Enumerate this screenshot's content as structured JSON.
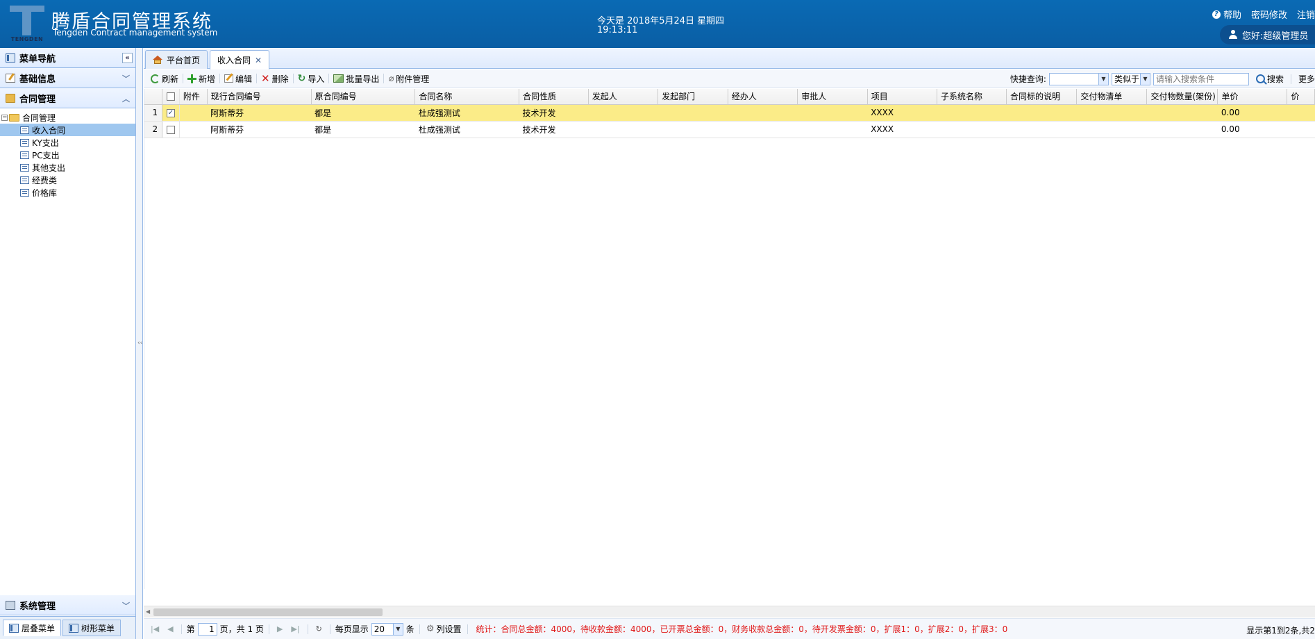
{
  "header": {
    "logo_word": "TENGDEN",
    "title_cn": "腾盾合同管理系统",
    "title_en": "Tengden Contract management system",
    "date": "今天是 2018年5月24日 星期四",
    "time": "19:13:11",
    "help": "帮助",
    "change_password": "密码修改",
    "logout": "注销",
    "greeting": "您好:超级管理员"
  },
  "sidebar": {
    "nav_title": "菜单导航",
    "sections": {
      "basic": "基础信息",
      "contract": "合同管理",
      "system": "系统管理"
    },
    "tree": {
      "root": "合同管理",
      "items": [
        "收入合同",
        "KY支出",
        "PC支出",
        "其他支出",
        "经费类",
        "价格库"
      ]
    },
    "bottom_tabs": [
      "层叠菜单",
      "树形菜单"
    ]
  },
  "tabs": [
    "平台首页",
    "收入合同"
  ],
  "toolbar": {
    "refresh": "刷新",
    "add": "新增",
    "edit": "编辑",
    "delete": "删除",
    "import": "导入",
    "batch_export": "批量导出",
    "attachments": "附件管理",
    "quick_query_label": "快捷查询:",
    "quick_field_value": "",
    "match_mode": "类似于",
    "search_placeholder": "请输入搜索条件",
    "search": "搜索",
    "more": "更多"
  },
  "grid": {
    "columns": [
      "附件",
      "现行合同编号",
      "原合同编号",
      "合同名称",
      "合同性质",
      "发起人",
      "发起部门",
      "经办人",
      "审批人",
      "项目",
      "子系统名称",
      "合同标的说明",
      "交付物清单",
      "交付物数量(架份)",
      "单价",
      "价"
    ],
    "rows": [
      {
        "num": "1",
        "checked": true,
        "cells": [
          "",
          "阿斯蒂芬",
          "都是",
          "杜成强测试",
          "技术开发",
          "",
          "",
          "",
          "",
          "XXXX",
          "",
          "",
          "",
          "",
          "0.00",
          ""
        ]
      },
      {
        "num": "2",
        "checked": false,
        "cells": [
          "",
          "阿斯蒂芬",
          "都是",
          "杜成强测试",
          "技术开发",
          "",
          "",
          "",
          "",
          "XXXX",
          "",
          "",
          "",
          "",
          "0.00",
          ""
        ]
      }
    ]
  },
  "pager": {
    "page_prefix": "第",
    "page_value": "1",
    "page_suffix": "页，共 1 页",
    "per_page_label": "每页显示",
    "per_page_value": "20",
    "per_page_unit": "条",
    "column_settings": "列设置",
    "stats": "统计：合同总金额：4000，待收款金额：4000，已开票总金额：0，财务收款总金额：0，待开发票金额：0，扩展1：0，扩展2：0，扩展3：0",
    "info": "显示第1到2条,共2"
  }
}
